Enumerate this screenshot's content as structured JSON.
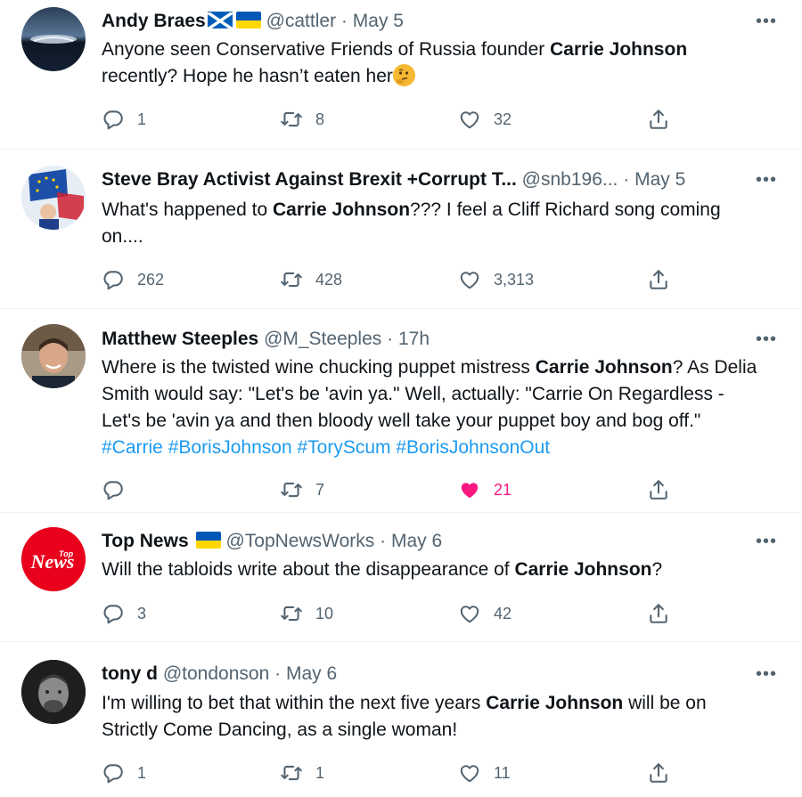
{
  "tweets": [
    {
      "name": "Andy Braes",
      "handle": "@cattler",
      "sep": "·",
      "time": "May 5",
      "text": {
        "t1": "Anyone seen Conservative Friends of Russia founder ",
        "b1": "Carrie Johnson",
        "t2": " recently? Hope he hasn’t eaten her"
      },
      "replies": "1",
      "retweets": "8",
      "likes": "32",
      "name_flags": [
        "scotland-flag",
        "ukraine-flag"
      ],
      "emoji": "thinking-face-emoji"
    },
    {
      "name": "Steve Bray Activist Against Brexit +Corrupt T...",
      "handle": "@snb196...",
      "sep": "·",
      "time": "May 5",
      "text": {
        "b1": "Carrie Johnson",
        "t0": "What's happened to ",
        "t2": "??? I feel a Cliff Richard song coming on...."
      },
      "replies": "262",
      "retweets": "428",
      "likes": "3,313"
    },
    {
      "name": "Matthew Steeples",
      "handle": "@M_Steeples",
      "sep": "·",
      "time": "17h",
      "text": {
        "t0": "Where is the twisted wine chucking puppet mistress ",
        "b1": "Carrie Johnson",
        "t2": "? As Delia Smith would say: \"Let's be 'avin ya.\" Well, actually: \"Carrie On Regardless - Let's be 'avin ya and then bloody well take your puppet boy and bog off.\" ",
        "tags": [
          "#Carrie",
          "#BorisJohnson",
          "#ToryScum",
          "#BorisJohnsonOut"
        ]
      },
      "replies": "",
      "retweets": "7",
      "likes": "21",
      "liked": true
    },
    {
      "name": "Top News",
      "handle": "@TopNewsWorks",
      "sep": "·",
      "time": "May 6",
      "avatar_logo": {
        "small": "Top",
        "big": "News"
      },
      "text": {
        "t0": "Will the tabloids write about the disappearance of ",
        "b1": "Carrie Johnson",
        "t2": "?"
      },
      "replies": "3",
      "retweets": "10",
      "likes": "42",
      "name_flags": [
        "ukraine-flag"
      ]
    },
    {
      "name": "tony d",
      "handle": "@tondonson",
      "sep": "·",
      "time": "May 6",
      "text": {
        "t0": "I'm willing to bet that within the next five years ",
        "b1": "Carrie Johnson",
        "t2": " will be on Strictly Come Dancing, as a single woman!"
      },
      "replies": "1",
      "retweets": "1",
      "likes": "11"
    }
  ],
  "more_glyph": "•••",
  "colors": {
    "muted": "#536471",
    "link": "#1d9bf0",
    "like_active": "#f91880",
    "divider": "#eff3f4",
    "ukraine_blue": "#0057b7",
    "ukraine_yellow": "#ffd700",
    "scotland_blue": "#005eb8",
    "topnews_red": "#e8001c"
  }
}
